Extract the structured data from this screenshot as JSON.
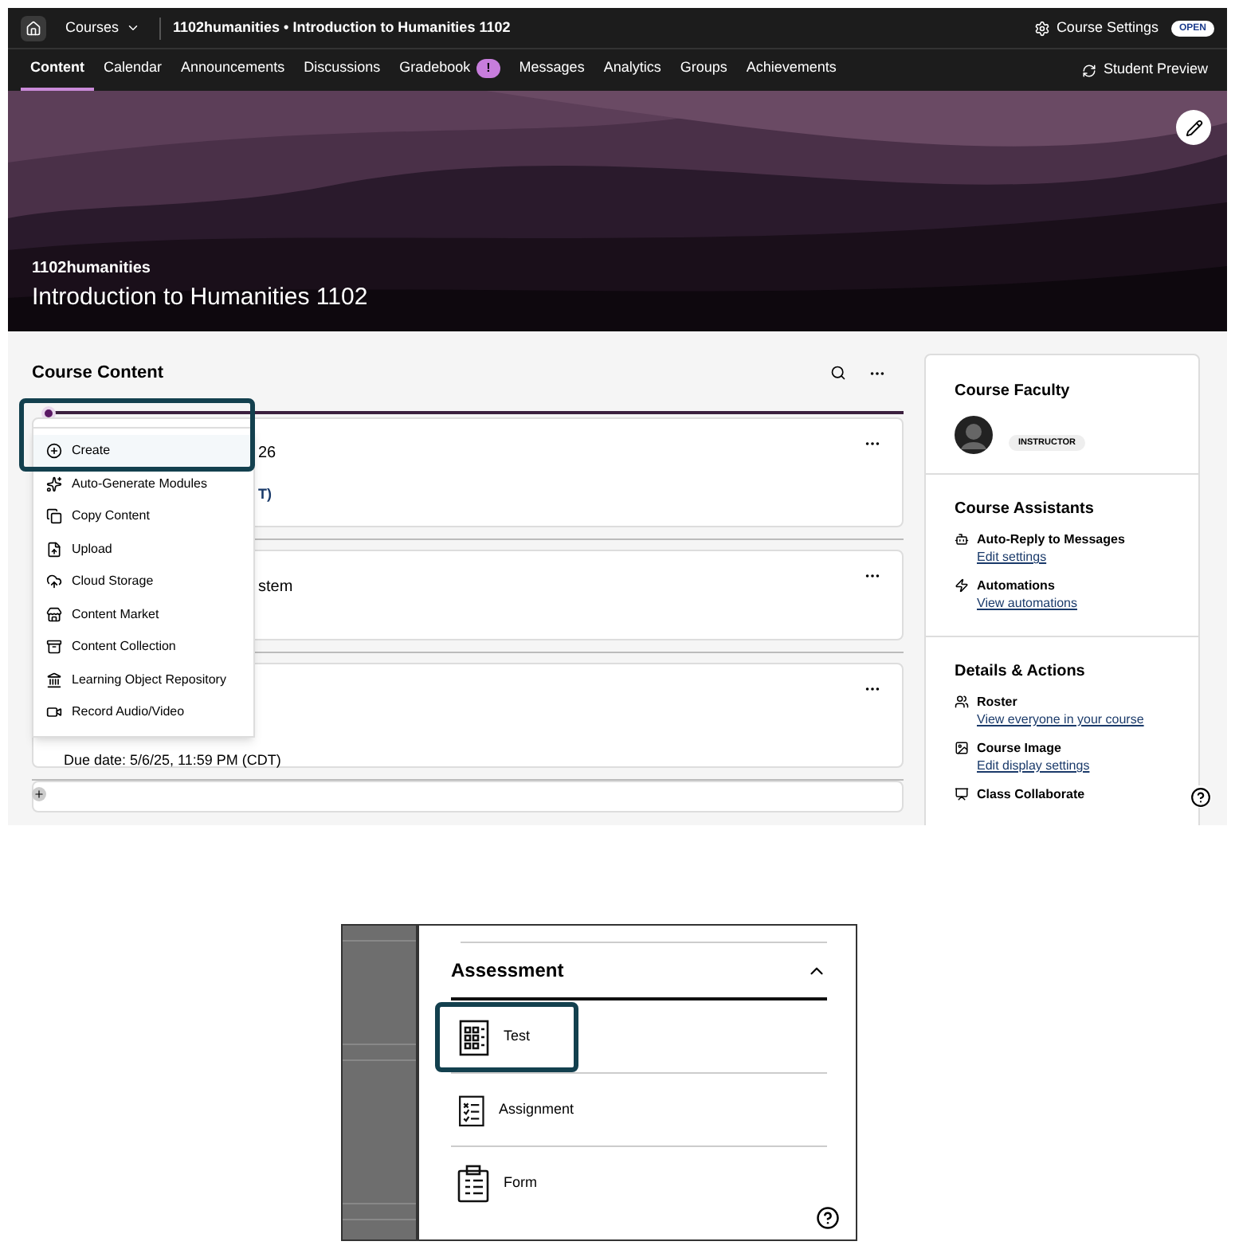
{
  "top_bar": {
    "courses_menu": "Courses",
    "course_path": "1102humanities • Introduction to Humanities 1102",
    "settings": "Course Settings",
    "status_badge": "OPEN"
  },
  "nav_tabs": [
    {
      "label": "Content",
      "selected": true
    },
    {
      "label": "Calendar",
      "selected": false
    },
    {
      "label": "Announcements",
      "selected": false
    },
    {
      "label": "Discussions",
      "selected": false
    },
    {
      "label": "Gradebook",
      "selected": false,
      "alert": "!"
    },
    {
      "label": "Messages",
      "selected": false
    },
    {
      "label": "Analytics",
      "selected": false
    },
    {
      "label": "Groups",
      "selected": false
    },
    {
      "label": "Achievements",
      "selected": false
    }
  ],
  "student_preview": "Student Preview",
  "banner": {
    "course_id": "1102humanities",
    "title": "Introduction to Humanities 1102"
  },
  "course_content": {
    "title": "Course Content",
    "items": [
      {
        "title": "26",
        "detail": "T)"
      },
      {
        "title": "stem"
      },
      {
        "detail": "Due date: 5/6/25, 11:59 PM (CDT)"
      }
    ]
  },
  "create_menu": [
    {
      "label": "Create",
      "selected": true
    },
    {
      "label": "Auto-Generate Modules",
      "selected": false
    },
    {
      "label": "Copy Content",
      "selected": false
    },
    {
      "label": "Upload",
      "selected": false
    },
    {
      "label": "Cloud Storage",
      "selected": false
    },
    {
      "label": "Content Market",
      "selected": false
    },
    {
      "label": "Content Collection",
      "selected": false
    },
    {
      "label": "Learning Object Repository",
      "selected": false
    },
    {
      "label": "Record Audio/Video",
      "selected": false
    }
  ],
  "sidebar": {
    "faculty": {
      "title": "Course Faculty",
      "role": "INSTRUCTOR"
    },
    "sections": [
      {
        "title": "Course Assistants",
        "items": [
          {
            "label": "Auto-Reply to Messages",
            "link": "Edit settings"
          },
          {
            "label": "Automations",
            "link": "View automations"
          }
        ]
      },
      {
        "title": "Details & Actions",
        "items": [
          {
            "label": "Roster",
            "link": "View everyone in your course"
          },
          {
            "label": "Course Image",
            "link": "Edit display settings"
          },
          {
            "label": "Class Collaborate"
          }
        ]
      }
    ]
  },
  "assessment_panel": {
    "title": "Assessment",
    "expanded": true,
    "items": [
      {
        "label": "Test",
        "selected": true
      },
      {
        "label": "Assignment",
        "selected": false
      },
      {
        "label": "Form",
        "selected": false
      }
    ]
  }
}
